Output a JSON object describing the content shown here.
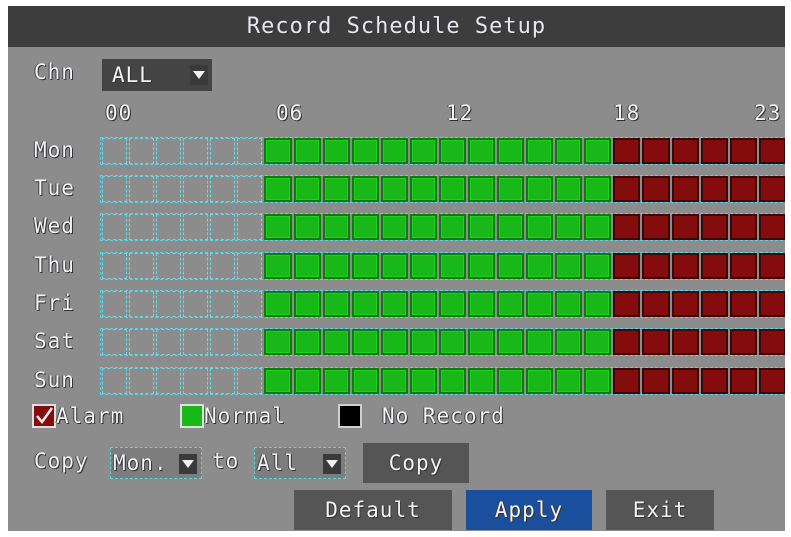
{
  "title": "Record Schedule Setup",
  "channel": {
    "label": "Chn",
    "selected": "ALL",
    "dropdown_icon": "chevron-down-icon"
  },
  "hour_labels": [
    "00",
    "06",
    "12",
    "18",
    "23"
  ],
  "days": [
    "Mon",
    "Tue",
    "Wed",
    "Thu",
    "Fri",
    "Sat",
    "Sun"
  ],
  "schedule": {
    "hours_per_day": 24,
    "normal_from_hour": 6,
    "alarm_from_hour": 18,
    "note_states": "hours 0-5 none, 6-17 normal, 18-23 alarm (identical for all days)"
  },
  "legend": {
    "alarm": "Alarm",
    "normal": "Normal",
    "none": "No Record"
  },
  "colors": {
    "normal": "#18b818",
    "alarm": "#850c0c",
    "none": "#8c8c8c",
    "accent": "#1a4f9e"
  },
  "copy": {
    "label": "Copy",
    "from": "Mon.",
    "to_label": "to",
    "to": "All",
    "button": "Copy"
  },
  "buttons": {
    "default": "Default",
    "apply": "Apply",
    "exit": "Exit"
  }
}
